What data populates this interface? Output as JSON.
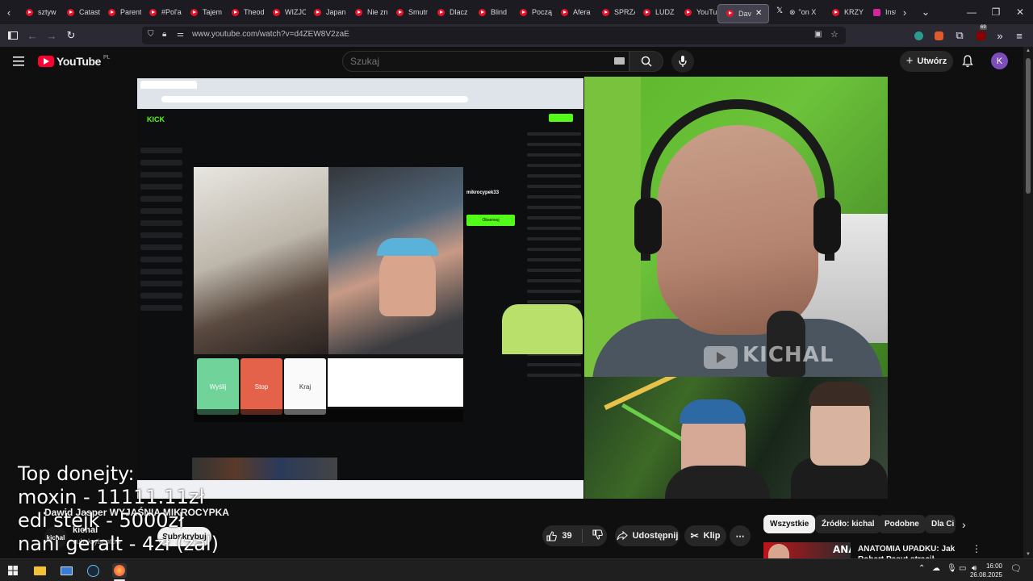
{
  "browser": {
    "tabs": [
      {
        "label": "sztyw",
        "icon": "youtube-icon"
      },
      {
        "label": "Catast",
        "icon": "youtube-icon"
      },
      {
        "label": "Parent",
        "icon": "youtube-icon"
      },
      {
        "label": "#Pol'a",
        "icon": "youtube-icon"
      },
      {
        "label": "Tajem",
        "icon": "youtube-icon"
      },
      {
        "label": "Theod",
        "icon": "youtube-icon"
      },
      {
        "label": "WIZJC",
        "icon": "youtube-icon"
      },
      {
        "label": "Japan",
        "icon": "youtube-icon"
      },
      {
        "label": "Nie zn",
        "icon": "youtube-icon"
      },
      {
        "label": "Smutr",
        "icon": "youtube-icon"
      },
      {
        "label": "Dlacz",
        "icon": "youtube-icon"
      },
      {
        "label": "Blind",
        "icon": "youtube-icon"
      },
      {
        "label": "Począ",
        "icon": "youtube-icon"
      },
      {
        "label": "Afera",
        "icon": "youtube-icon"
      },
      {
        "label": "SPRZA",
        "icon": "youtube-icon"
      },
      {
        "label": "LUDZ",
        "icon": "youtube-icon"
      },
      {
        "label": "YouTu",
        "icon": "youtube-icon"
      }
    ],
    "active_tab": {
      "label": "Dav",
      "icon": "youtube-icon",
      "audio": "speaker-icon"
    },
    "trailing_tabs": [
      {
        "label": "\"on X",
        "icon": "x-icon"
      },
      {
        "label": "KRZY",
        "icon": "youtube-icon"
      },
      {
        "label": "Insta",
        "icon": "instagram-icon"
      }
    ],
    "url": "www.youtube.com/watch?v=d4ZEW8V2zaE",
    "extension_badge": "69"
  },
  "youtube": {
    "logo_text": "YouTube",
    "logo_region": "PL",
    "search_placeholder": "Szukaj",
    "create_label": "Utwórz",
    "avatar_letter": "K"
  },
  "video": {
    "overlay_donations": [
      "Top donejty:",
      "moxin - 11111.11zł",
      "edi stejk - 5000zł",
      "nani geralt - 4zł (zal)"
    ],
    "watermark": "KICHAL",
    "inner_buttons": {
      "start": "Wyślij",
      "stop": "Stop",
      "next": "Kraj"
    },
    "inner_stream_title": "mikrocypek33",
    "inner_follow": "Obserwuj"
  },
  "meta": {
    "title": "Dawid Jasper WYJAŚNIA MIKROCYPKA",
    "channel_logo": "kichal",
    "channel_name": "kichal",
    "subscribers": "subskrybentów",
    "subscribe_label": "Subskrybuj",
    "likes": "39",
    "share_label": "Udostępnij",
    "clip_label": "Klip",
    "more_label": "⋯"
  },
  "recommendations": {
    "chips": [
      "Wszystkie",
      "Źródło: kichal",
      "Podobne",
      "Dla Ci"
    ],
    "first": {
      "thumb_text": "ANALIZA",
      "title": "ANATOMIA UPADKU: Jak Robert Pasut stracił wszystko"
    }
  },
  "taskbar": {
    "time": "16:00",
    "date": "26.08.2025"
  },
  "colors": {
    "youtube_red": "#ff0033",
    "kick_green": "#53fc18",
    "avatar": "#7c4dbb"
  }
}
